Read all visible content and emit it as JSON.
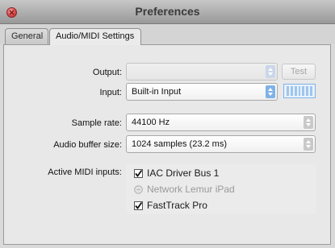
{
  "window": {
    "title": "Preferences"
  },
  "tabs": [
    {
      "label": "General",
      "active": false
    },
    {
      "label": "Audio/MIDI Settings",
      "active": true
    }
  ],
  "output": {
    "label": "Output:",
    "value": "",
    "test_label": "Test"
  },
  "input": {
    "label": "Input:",
    "value": "Built-in Input"
  },
  "sample_rate": {
    "label": "Sample rate:",
    "value": "44100 Hz"
  },
  "buffer_size": {
    "label": "Audio buffer size:",
    "value": "1024 samples (23.2 ms)"
  },
  "midi": {
    "label": "Active MIDI inputs:",
    "inputs": [
      {
        "label": "IAC Driver Bus 1",
        "checked": true,
        "enabled": true
      },
      {
        "label": "Network Lemur iPad",
        "checked": false,
        "enabled": false
      },
      {
        "label": "FastTrack Pro",
        "checked": true,
        "enabled": true
      }
    ]
  },
  "colors": {
    "accent": "#7fb2e6",
    "close": "#d94a4a"
  }
}
